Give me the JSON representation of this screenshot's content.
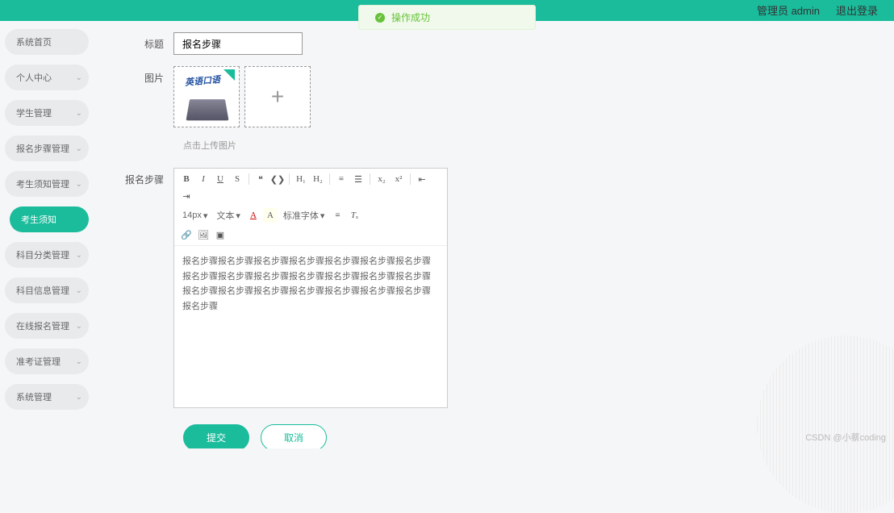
{
  "header": {
    "admin_label": "管理员 admin",
    "logout_label": "退出登录"
  },
  "notification": {
    "message": "操作成功"
  },
  "sidebar": {
    "items": [
      {
        "label": "系统首页",
        "has_chev": false
      },
      {
        "label": "个人中心",
        "has_chev": true
      },
      {
        "label": "学生管理",
        "has_chev": true
      },
      {
        "label": "报名步骤管理",
        "has_chev": true
      },
      {
        "label": "考生须知管理",
        "has_chev": true
      },
      {
        "label": "考生须知",
        "has_chev": false,
        "active": true,
        "sub": true
      },
      {
        "label": "科目分类管理",
        "has_chev": true
      },
      {
        "label": "科目信息管理",
        "has_chev": true
      },
      {
        "label": "在线报名管理",
        "has_chev": true
      },
      {
        "label": "准考证管理",
        "has_chev": true
      },
      {
        "label": "系统管理",
        "has_chev": true
      }
    ]
  },
  "form": {
    "title_label": "标题",
    "title_value": "报名步骤",
    "image_label": "图片",
    "image_text": "英语口语",
    "upload_hint": "点击上传图片",
    "steps_label": "报名步骤",
    "editor": {
      "font_size": "14px",
      "text_type": "文本",
      "font_family": "标准字体",
      "content": "报名步骤报名步骤报名步骤报名步骤报名步骤报名步骤报名步骤报名步骤报名步骤报名步骤报名步骤报名步骤报名步骤报名步骤报名步骤报名步骤报名步骤报名步骤报名步骤报名步骤报名步骤报名步骤"
    },
    "submit_label": "提交",
    "cancel_label": "取消"
  },
  "watermark": "CSDN @小蔡coding"
}
